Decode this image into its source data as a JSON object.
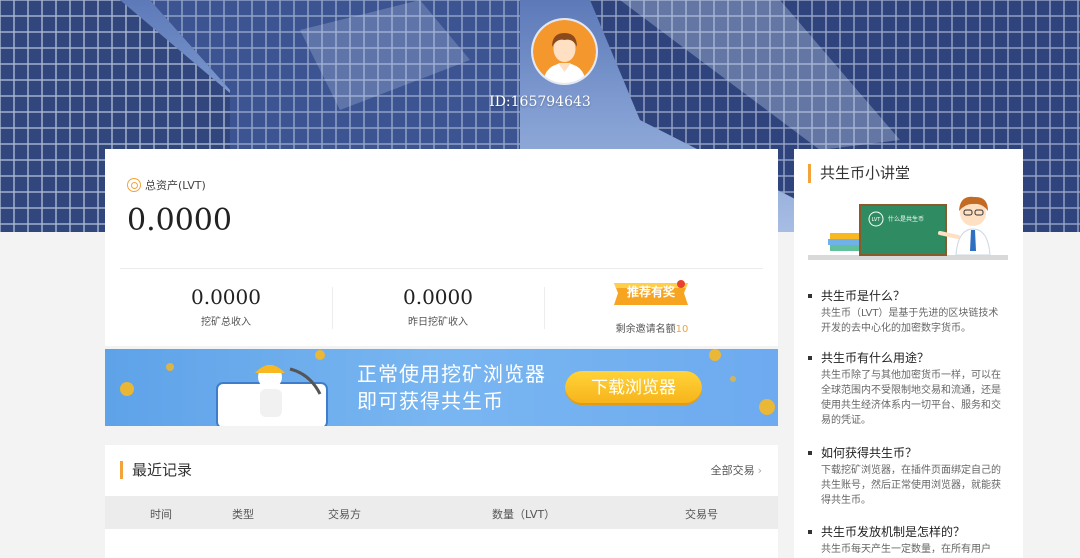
{
  "user": {
    "id_label": "ID:165794643"
  },
  "assets": {
    "total_label": "总资产(LVT)",
    "total_value": "0.0000",
    "stats": [
      {
        "value": "0.0000",
        "label": "挖矿总收入"
      },
      {
        "value": "0.0000",
        "label": "昨日挖矿收入"
      }
    ],
    "recommend_label": "推荐有奖",
    "invite_text": "剩余邀请名额",
    "invite_count": "10"
  },
  "banner": {
    "line1": "正常使用挖矿浏览器",
    "line2": "即可获得共生币",
    "button_label": "下载浏览器"
  },
  "records": {
    "title": "最近记录",
    "all_link": "全部交易",
    "columns": [
      "时间",
      "类型",
      "交易方",
      "数量（LVT）",
      "交易号"
    ]
  },
  "sidebar": {
    "title": "共生币小讲堂",
    "board_text": "什么是共生币",
    "faqs": [
      {
        "q": "共生币是什么？",
        "a": "共生币（LVT）是基于先进的区块链技术开发的去中心化的加密数字货币。"
      },
      {
        "q": "共生币有什么用途？",
        "a": "共生币除了与其他加密货币一样，可以在全球范围内不受限制地交易和流通，还是使用共生经济体系内一切平台、服务和交易的凭证。"
      },
      {
        "q": "如何获得共生币？",
        "a": "下载挖矿浏览器，在插件页面绑定自己的共生账号，然后正常使用浏览器，就能获得共生币。"
      },
      {
        "q": "共生币发放机制是怎样的？",
        "a": "共生币每天产生一定数量，在所有用户"
      }
    ]
  },
  "colors": {
    "accent": "#f2a33a",
    "banner": "#6daaf0",
    "hero": "#7f9bd0"
  }
}
